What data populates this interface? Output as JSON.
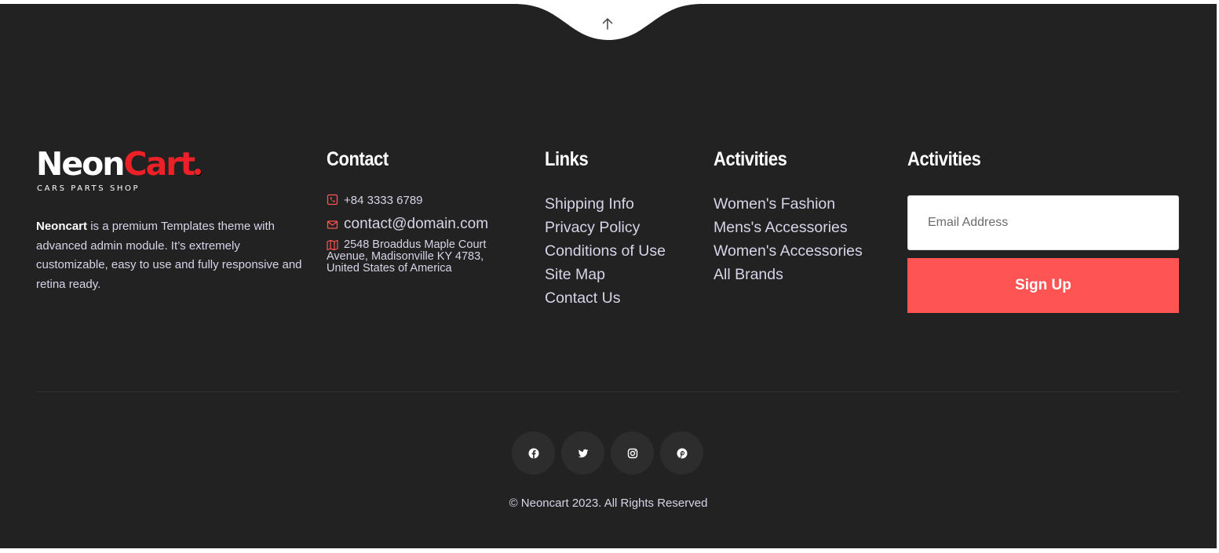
{
  "brand": {
    "logo_main": "Neon",
    "logo_accent": "Cart",
    "tagline": "CARS PARTS SHOP",
    "about_bold": "Neoncart",
    "about_text": " is a premium Templates theme with advanced admin module. It’s extremely customizable, easy to use and fully responsive and retina ready."
  },
  "contact": {
    "title": "Contact",
    "phone": "+84 3333 6789",
    "email": "contact@domain.com",
    "address_line1": "2548 Broaddus Maple Court",
    "address_line2": "Avenue, Madisonville KY 4783,",
    "address_line3": "United States of America"
  },
  "links": {
    "title": "Links",
    "items": [
      "Shipping Info",
      "Privacy Policy",
      "Conditions of Use",
      "Site Map",
      "Contact Us"
    ]
  },
  "activities": {
    "title": "Activities",
    "items": [
      "Women's Fashion",
      "Mens's Accessories",
      "Women's Accessories",
      "All Brands"
    ]
  },
  "newsletter": {
    "title": "Activities",
    "placeholder": "Email Address",
    "button_label": "Sign Up"
  },
  "socials": [
    "facebook-icon",
    "twitter-icon",
    "instagram-icon",
    "pinterest-icon"
  ],
  "copyright": "© Neoncart 2023. All Rights Reserved",
  "colors": {
    "background": "#222222",
    "accent": "#ed2027",
    "button": "#ff5454",
    "text": "#d8d4e8"
  }
}
